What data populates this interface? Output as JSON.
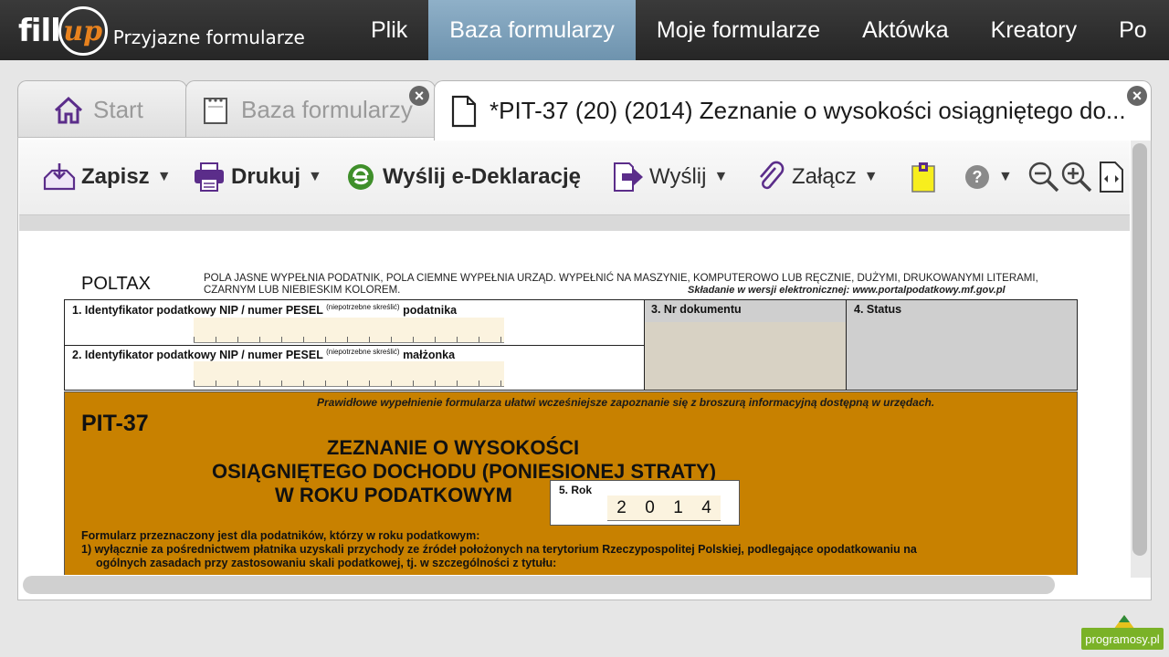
{
  "app": {
    "logo_text": "fill",
    "logo_script": "up",
    "tagline": "Przyjazne formularze"
  },
  "nav": {
    "items": [
      "Plik",
      "Baza formularzy",
      "Moje formularze",
      "Aktówka",
      "Kreatory",
      "Po"
    ],
    "active_index": 1
  },
  "tabs": {
    "start": "Start",
    "baza": "Baza formularzy",
    "document": "*PIT-37 (20) (2014) Zeznanie o wysokości osiągniętego do..."
  },
  "toolbar": {
    "save": "Zapisz",
    "print": "Drukuj",
    "edeclaration": "Wyślij e-Deklarację",
    "send": "Wyślij",
    "attach": "Załącz"
  },
  "form": {
    "poltax": "POLTAX",
    "instructions": "POLA JASNE WYPEŁNIA PODATNIK, POLA CIEMNE WYPEŁNIA URZĄD. WYPEŁNIĆ NA MASZYNIE, KOMPUTEROWO LUB RĘCZNIE, DUŻYMI, DRUKOWANYMI LITERAMI, CZARNYM LUB NIEBIESKIM KOLOREM.",
    "electronic": "Składanie w wersji elektronicznej: www.portalpodatkowy.mf.gov.pl",
    "field1_label": "1. Identyfikator podatkowy NIP / numer PESEL",
    "field1_note": "(niepotrzebne skreślić)",
    "field1_suffix": "podatnika",
    "field2_label": "2. Identyfikator podatkowy NIP / numer PESEL",
    "field2_note": "(niepotrzebne skreślić)",
    "field2_suffix": "małżonka",
    "field3_label": "3. Nr dokumentu",
    "field4_label": "4. Status",
    "correct_fill": "Prawidłowe wypełnienie formularza ułatwi wcześniejsze zapoznanie się z broszurą informacyjną dostępną w urzędach.",
    "form_code": "PIT-37",
    "title_line1": "ZEZNANIE O WYSOKOŚCI",
    "title_line2": "OSIĄGNIĘTEGO DOCHODU (PONIESIONEJ STRATY)",
    "title_line3": "W ROKU PODATKOWYM",
    "year_label": "5. Rok",
    "year_digits": [
      "2",
      "0",
      "1",
      "4"
    ],
    "intended": "Formularz przeznaczony jest dla podatników, którzy w roku podatkowym:",
    "point1": "1) wyłącznie za pośrednictwem płatnika uzyskali przychody ze źródeł położonych na terytorium Rzeczypospolitej Polskiej, podlegające opodatkowaniu na",
    "point1_cont": "ogólnych zasadach przy zastosowaniu skali podatkowej, tj. w szczególności z tytułu:"
  },
  "watermark": "programosy.pl",
  "colors": {
    "nav_active": "#7fa3bd",
    "form_orange": "#c88100",
    "light_field": "#fbf3df",
    "toolbar_purple": "#5b2d8a"
  }
}
